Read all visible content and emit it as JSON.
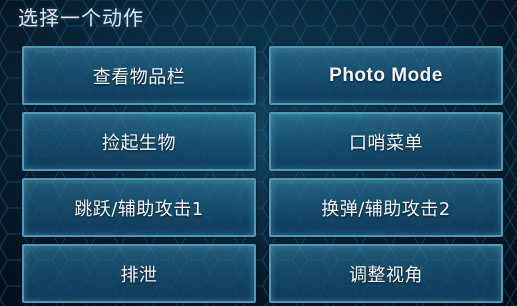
{
  "menu": {
    "title": "选择一个动作",
    "buttons": [
      {
        "label": "查看物品栏"
      },
      {
        "label": "Photo Mode"
      },
      {
        "label": "捡起生物"
      },
      {
        "label": "口哨菜单"
      },
      {
        "label": "跳跃/辅助攻击1"
      },
      {
        "label": "换弹/辅助攻击2"
      },
      {
        "label": "排泄"
      },
      {
        "label": "调整视角"
      }
    ]
  },
  "colors": {
    "background": "#072235",
    "button_border": "#4f98b6",
    "button_fill": "#1b5a7d",
    "text": "#f3f6f8"
  }
}
